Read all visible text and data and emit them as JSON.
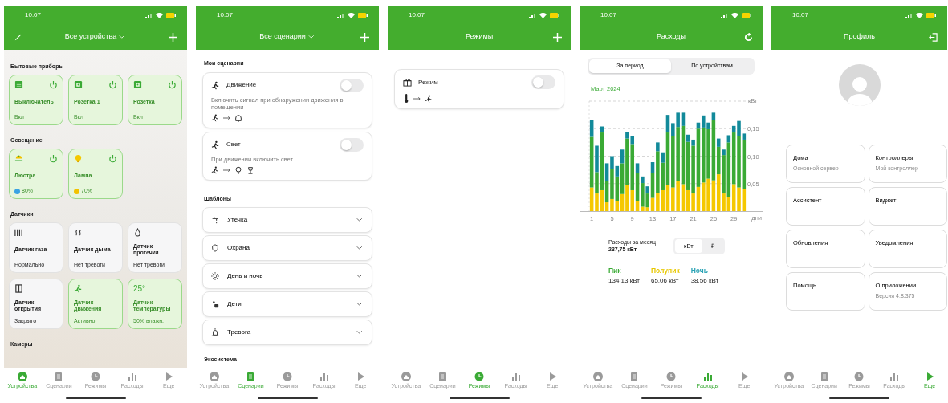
{
  "screens": [
    {
      "kind": "devices",
      "status_time": "10:07",
      "title": "Все устройства",
      "sections": [
        {
          "heading": "Бытовые приборы",
          "cards": [
            {
              "kind": "switch",
              "name": "Выключатель",
              "state": "Вкл",
              "on": true
            },
            {
              "kind": "socket",
              "name": "Розетка 1",
              "state": "Вкл",
              "on": true
            },
            {
              "kind": "socket",
              "name": "Розетка",
              "state": "Вкл",
              "on": true
            }
          ]
        },
        {
          "heading": "Освещение",
          "cards": [
            {
              "kind": "chandelier",
              "name": "Люстра",
              "state": "80%",
              "color": "#3aa3e3",
              "on": true
            },
            {
              "kind": "lamp",
              "name": "Лампа",
              "state": "70%",
              "color": "#f2c200",
              "on": true
            }
          ]
        },
        {
          "heading": "Датчики",
          "cards": [
            {
              "kind": "gas",
              "name": "Датчик газа",
              "state": "Нормально",
              "on": false
            },
            {
              "kind": "smoke",
              "name": "Датчик дыма",
              "state": "Нет тревоги",
              "on": false
            },
            {
              "kind": "leak",
              "name": "Датчик протечки",
              "state": "Нет тревоги",
              "on": false
            },
            {
              "kind": "door",
              "name": "Датчик открытия",
              "state": "Закрыто",
              "on": false
            },
            {
              "kind": "motion",
              "name": "Датчик движения",
              "state": "Активно",
              "on": true
            },
            {
              "kind": "temperature",
              "reading": "25°",
              "name": "Датчик температуры",
              "state": "50% влажн.",
              "on": true
            }
          ]
        },
        {
          "heading": "Камеры"
        }
      ],
      "tabs": [
        {
          "kind": "devices",
          "label": "Устройства",
          "selected": true
        },
        {
          "kind": "scenarios",
          "label": "Сценарии",
          "selected": false
        },
        {
          "kind": "modes",
          "label": "Режимы",
          "selected": false
        },
        {
          "kind": "expenses",
          "label": "Расходы",
          "selected": false
        },
        {
          "kind": "more",
          "label": "Еще",
          "selected": false
        }
      ]
    },
    {
      "kind": "scenarios",
      "status_time": "10:07",
      "title": "Все сценарии",
      "my_heading": "Мои сценарии",
      "my_scenarios": [
        {
          "kind": "motion-alarm",
          "name": "Движение",
          "description": "Включить сигнал при обнаружении движения в помещении",
          "on": false
        },
        {
          "kind": "motion-light",
          "name": "Свет",
          "description": "При движении включить свет",
          "on": false
        }
      ],
      "templates_heading": "Шаблоны",
      "templates": [
        {
          "kind": "leak",
          "name": "Утечка",
          "expanded": false
        },
        {
          "kind": "guard",
          "name": "Охрана",
          "expanded": false
        },
        {
          "kind": "daynight",
          "name": "День и ночь",
          "expanded": false
        },
        {
          "kind": "kids",
          "name": "Дети",
          "expanded": false
        },
        {
          "kind": "alarm",
          "name": "Тревога",
          "expanded": false
        }
      ],
      "footer_heading": "Экосистема",
      "tabs": [
        {
          "kind": "devices",
          "label": "Устройства",
          "selected": false
        },
        {
          "kind": "scenarios",
          "label": "Сценарии",
          "selected": true
        },
        {
          "kind": "modes",
          "label": "Режимы",
          "selected": false
        },
        {
          "kind": "expenses",
          "label": "Расходы",
          "selected": false
        },
        {
          "kind": "more",
          "label": "Еще",
          "selected": false
        }
      ]
    },
    {
      "kind": "modes",
      "status_time": "10:07",
      "title": "Режимы",
      "modes": [
        {
          "name": "Режим",
          "on": false
        }
      ],
      "tabs": [
        {
          "kind": "devices",
          "label": "Устройства",
          "selected": false
        },
        {
          "kind": "scenarios",
          "label": "Сценарии",
          "selected": false
        },
        {
          "kind": "modes",
          "label": "Режимы",
          "selected": true
        },
        {
          "kind": "expenses",
          "label": "Расходы",
          "selected": false
        },
        {
          "kind": "more",
          "label": "Еще",
          "selected": false
        }
      ]
    },
    {
      "kind": "expenses",
      "status_time": "10:07",
      "title": "Расходы",
      "segments": [
        {
          "label": "За период",
          "selected": true
        },
        {
          "label": "По устройствам",
          "selected": false
        }
      ],
      "period": "Март 2024",
      "chart_data": {
        "type": "bar",
        "stacked": true,
        "xlabel": "дни",
        "ylabel": "кВт",
        "grid": true,
        "x": [
          1,
          2,
          3,
          4,
          5,
          6,
          7,
          8,
          9,
          10,
          11,
          12,
          13,
          14,
          15,
          16,
          17,
          18,
          19,
          20,
          21,
          22,
          23,
          24,
          25,
          26,
          27,
          28,
          29,
          30,
          31
        ],
        "xlim": [
          0.5,
          31.5
        ],
        "xticks": [
          1,
          5,
          9,
          13,
          17,
          21,
          25,
          29
        ],
        "ylim": [
          0,
          0.2
        ],
        "yticks": [
          {
            "value": 0.05,
            "label": "0,05"
          },
          {
            "value": 0.1,
            "label": "0,10"
          },
          {
            "value": 0.15,
            "label": "0,15"
          }
        ],
        "series": [
          {
            "color": "#f5c800",
            "values": [
              0.043,
              0.032,
              0.038,
              0.016,
              0.022,
              0.019,
              0.031,
              0.047,
              0.038,
              0.019,
              0.008,
              0.007,
              0.024,
              0.033,
              0.038,
              0.047,
              0.043,
              0.054,
              0.049,
              0.038,
              0.032,
              0.044,
              0.052,
              0.059,
              0.056,
              0.067,
              0.032,
              0.025,
              0.049,
              0.043,
              0.04
            ]
          },
          {
            "color": "#3aaa35",
            "values": [
              0.092,
              0.039,
              0.105,
              0.038,
              0.054,
              0.044,
              0.056,
              0.085,
              0.084,
              0.051,
              0.043,
              0.025,
              0.045,
              0.076,
              0.05,
              0.096,
              0.093,
              0.099,
              0.106,
              0.088,
              0.087,
              0.106,
              0.1,
              0.09,
              0.11,
              0.05,
              0.07,
              0.1,
              0.094,
              0.093,
              0.09
            ]
          },
          {
            "color": "#128a9a",
            "values": [
              0.031,
              0.048,
              0.011,
              0.033,
              0.024,
              0.019,
              0.025,
              0.012,
              0.014,
              0.017,
              0.012,
              0.013,
              0.02,
              0.016,
              0.019,
              0.032,
              0.024,
              0.026,
              0.024,
              0.013,
              0.011,
              0.011,
              0.022,
              0.012,
              0.013,
              0.015,
              0.01,
              0.013,
              0.012,
              0.028,
              0.011
            ]
          }
        ]
      },
      "summary_label": "Расходы за месяц",
      "total": "237,75 кВт",
      "units": [
        {
          "label": "кВт",
          "selected": true
        },
        {
          "label": "₽",
          "selected": false
        }
      ],
      "breakdown": [
        {
          "label": "Пик",
          "value": "134,13 кВт",
          "color": "#3aaa35"
        },
        {
          "label": "Полупик",
          "value": "65,06 кВт",
          "color": "#e8c800"
        },
        {
          "label": "Ночь",
          "value": "38,56 кВт",
          "color": "#2aa3b5"
        }
      ],
      "tabs": [
        {
          "kind": "devices",
          "label": "Устройства",
          "selected": false
        },
        {
          "kind": "scenarios",
          "label": "Сценарии",
          "selected": false
        },
        {
          "kind": "modes",
          "label": "Режимы",
          "selected": false
        },
        {
          "kind": "expenses",
          "label": "Расходы",
          "selected": true
        },
        {
          "kind": "more",
          "label": "Еще",
          "selected": false
        }
      ]
    },
    {
      "kind": "profile",
      "status_time": "10:07",
      "title": "Профиль",
      "menu": [
        {
          "title": "Дома",
          "subtitle": "Основной сервер"
        },
        {
          "title": "Контроллеры",
          "subtitle": "Мой контроллер"
        },
        {
          "title": "Ассистент"
        },
        {
          "title": "Виджет"
        },
        {
          "title": "Обновления"
        },
        {
          "title": "Уведомления"
        },
        {
          "title": "Помощь"
        },
        {
          "title": "О приложении",
          "subtitle": "Версия 4.8.375"
        }
      ],
      "tabs": [
        {
          "kind": "devices",
          "label": "Устройства",
          "selected": false
        },
        {
          "kind": "scenarios",
          "label": "Сценарии",
          "selected": false
        },
        {
          "kind": "modes",
          "label": "Режимы",
          "selected": false
        },
        {
          "kind": "expenses",
          "label": "Расходы",
          "selected": false
        },
        {
          "kind": "more",
          "label": "Еще",
          "selected": true
        }
      ]
    }
  ]
}
